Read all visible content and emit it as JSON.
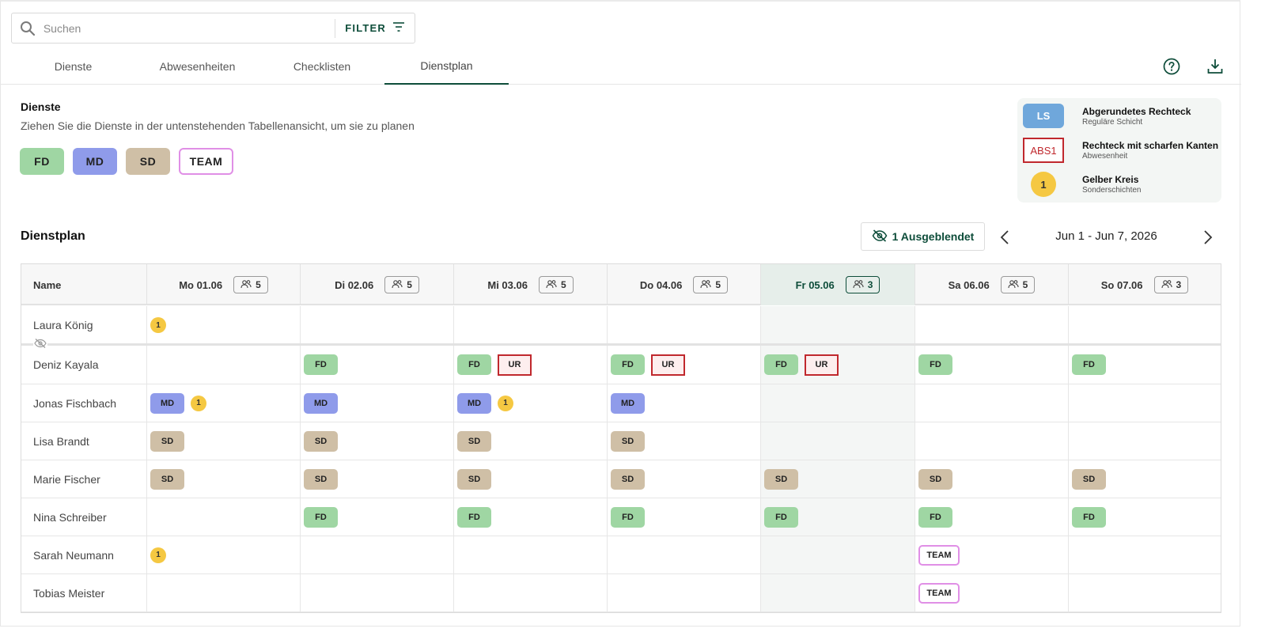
{
  "search": {
    "placeholder": "Suchen",
    "filter_label": "FILTER"
  },
  "tabs": [
    {
      "label": "Dienste"
    },
    {
      "label": "Abwesenheiten"
    },
    {
      "label": "Checklisten"
    },
    {
      "label": "Dienstplan",
      "active": true
    }
  ],
  "services": {
    "title": "Dienste",
    "subtitle": "Ziehen Sie die Dienste in der untenstehenden Tabellenansicht, um sie zu planen",
    "chips": [
      {
        "label": "FD",
        "color": "#9fd6a3"
      },
      {
        "label": "MD",
        "color": "#8f9bea"
      },
      {
        "label": "SD",
        "color": "#cfbfa6"
      },
      {
        "label": "TEAM",
        "color": "#e08fe6"
      }
    ]
  },
  "legend": [
    {
      "symbol": "LS",
      "title": "Abgerundetes Rechteck",
      "subtitle": "Reguläre Schicht",
      "color": "#6fa7db"
    },
    {
      "symbol": "ABS1",
      "title": "Rechteck mit scharfen Kanten",
      "subtitle": "Abwesenheit",
      "color": "#c0282d"
    },
    {
      "symbol": "1",
      "title": "Gelber Kreis",
      "subtitle": "Sonderschichten",
      "color": "#f5c842"
    }
  ],
  "plan": {
    "title": "Dienstplan",
    "hidden_label": "1 Ausgeblendet",
    "date_range": "Jun 1 - Jun 7, 2026",
    "name_header": "Name",
    "days": [
      {
        "label": "Mo 01.06",
        "count": "5"
      },
      {
        "label": "Di 02.06",
        "count": "5"
      },
      {
        "label": "Mi 03.06",
        "count": "5"
      },
      {
        "label": "Do 04.06",
        "count": "5"
      },
      {
        "label": "Fr 05.06",
        "count": "3",
        "today": true
      },
      {
        "label": "Sa 06.06",
        "count": "5"
      },
      {
        "label": "So 07.06",
        "count": "3"
      }
    ],
    "rows": [
      {
        "name": "Laura König",
        "cells": [
          [
            "1"
          ],
          [],
          [],
          [],
          [],
          [],
          []
        ]
      },
      {
        "name": "Deniz Kayala",
        "cells": [
          [],
          [
            "FD"
          ],
          [
            "FD",
            "UR"
          ],
          [
            "FD",
            "UR"
          ],
          [
            "FD",
            "UR"
          ],
          [
            "FD"
          ],
          [
            "FD"
          ]
        ]
      },
      {
        "name": "Jonas Fischbach",
        "cells": [
          [
            "MD",
            "1"
          ],
          [
            "MD"
          ],
          [
            "MD",
            "1"
          ],
          [
            "MD"
          ],
          [],
          [],
          []
        ]
      },
      {
        "name": "Lisa Brandt",
        "cells": [
          [
            "SD"
          ],
          [
            "SD"
          ],
          [
            "SD"
          ],
          [
            "SD"
          ],
          [],
          [],
          []
        ]
      },
      {
        "name": "Marie Fischer",
        "cells": [
          [
            "SD"
          ],
          [
            "SD"
          ],
          [
            "SD"
          ],
          [
            "SD"
          ],
          [
            "SD"
          ],
          [
            "SD"
          ],
          [
            "SD"
          ]
        ]
      },
      {
        "name": "Nina Schreiber",
        "cells": [
          [],
          [
            "FD"
          ],
          [
            "FD"
          ],
          [
            "FD"
          ],
          [
            "FD"
          ],
          [
            "FD"
          ],
          [
            "FD"
          ]
        ]
      },
      {
        "name": "Sarah Neumann",
        "cells": [
          [
            "1"
          ],
          [],
          [],
          [],
          [],
          [
            "TEAM"
          ],
          []
        ]
      },
      {
        "name": "Tobias Meister",
        "cells": [
          [],
          [],
          [],
          [],
          [],
          [
            "TEAM"
          ],
          []
        ]
      }
    ]
  },
  "colors": {
    "accent": "#0e4d3a",
    "FD": "#9fd6a3",
    "MD": "#8f9bea",
    "SD": "#cfbfa6",
    "absence": "#c0282d",
    "special": "#f5c842",
    "team": "#e08fe6"
  }
}
